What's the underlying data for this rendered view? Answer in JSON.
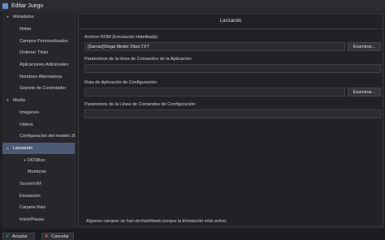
{
  "window": {
    "title": "Editar Juego"
  },
  "sidebar": {
    "items": [
      {
        "label": "Metadatos",
        "level": 0,
        "arrow": "▾",
        "selected": false
      },
      {
        "label": "Notas",
        "level": 1,
        "selected": false
      },
      {
        "label": "Campos Personalizados",
        "level": 1,
        "selected": false
      },
      {
        "label": "Ordenar Título",
        "level": 1,
        "selected": false
      },
      {
        "label": "Aplicaciones Adicionales",
        "level": 1,
        "selected": false
      },
      {
        "label": "Nombres Alternativos",
        "level": 1,
        "selected": false
      },
      {
        "label": "Soporte de Controlador",
        "level": 1,
        "selected": false
      },
      {
        "label": "Media",
        "level": 0,
        "arrow": "▾",
        "selected": false
      },
      {
        "label": "Imágenes",
        "level": 1,
        "selected": false
      },
      {
        "label": "Videos",
        "level": 1,
        "selected": false
      },
      {
        "label": "Configuración del modelo 3D",
        "level": 1,
        "selected": false
      },
      {
        "label": "Lanzando",
        "level": 0,
        "arrow": "▴",
        "selected": true
      },
      {
        "label": "DOSBox",
        "level": 1,
        "arrow": "▾",
        "selected": false
      },
      {
        "label": "Monturas",
        "level": 2,
        "selected": false
      },
      {
        "label": "ScummVM",
        "level": 1,
        "selected": false
      },
      {
        "label": "Emulación",
        "level": 1,
        "selected": false
      },
      {
        "label": "Carpeta Raíz",
        "level": 1,
        "selected": false
      },
      {
        "label": "Inicio/Pausa",
        "level": 1,
        "selected": false
      }
    ]
  },
  "panel": {
    "header": "Lanzando",
    "rom_label": "Archivo ROM (Emulación Habilitada):",
    "rom_value": "[Sarran]\\Sega Model 2\\bel.TXT",
    "browse_label": "Examinar...",
    "app_params_label": "Parámetros de la línea de Comandos de la Aplicación:",
    "app_params_value": "",
    "config_path_label": "Ruta de Aplicación de Configuración:",
    "config_path_value": "",
    "config_browse_label": "Examinar...",
    "config_params_label": "Parámetros de la Línea de Comandos de Configuración:",
    "config_params_value": "",
    "notice": "Algunos campos se han deshabilitado porque la Emulación está activo."
  },
  "footer": {
    "ok_label": "Aceptar",
    "cancel_label": "Cancelar"
  },
  "colors": {
    "selected_bg": "#4a5a74",
    "ok_icon": "#4fb35a",
    "cancel_icon": "#d64a4a"
  }
}
